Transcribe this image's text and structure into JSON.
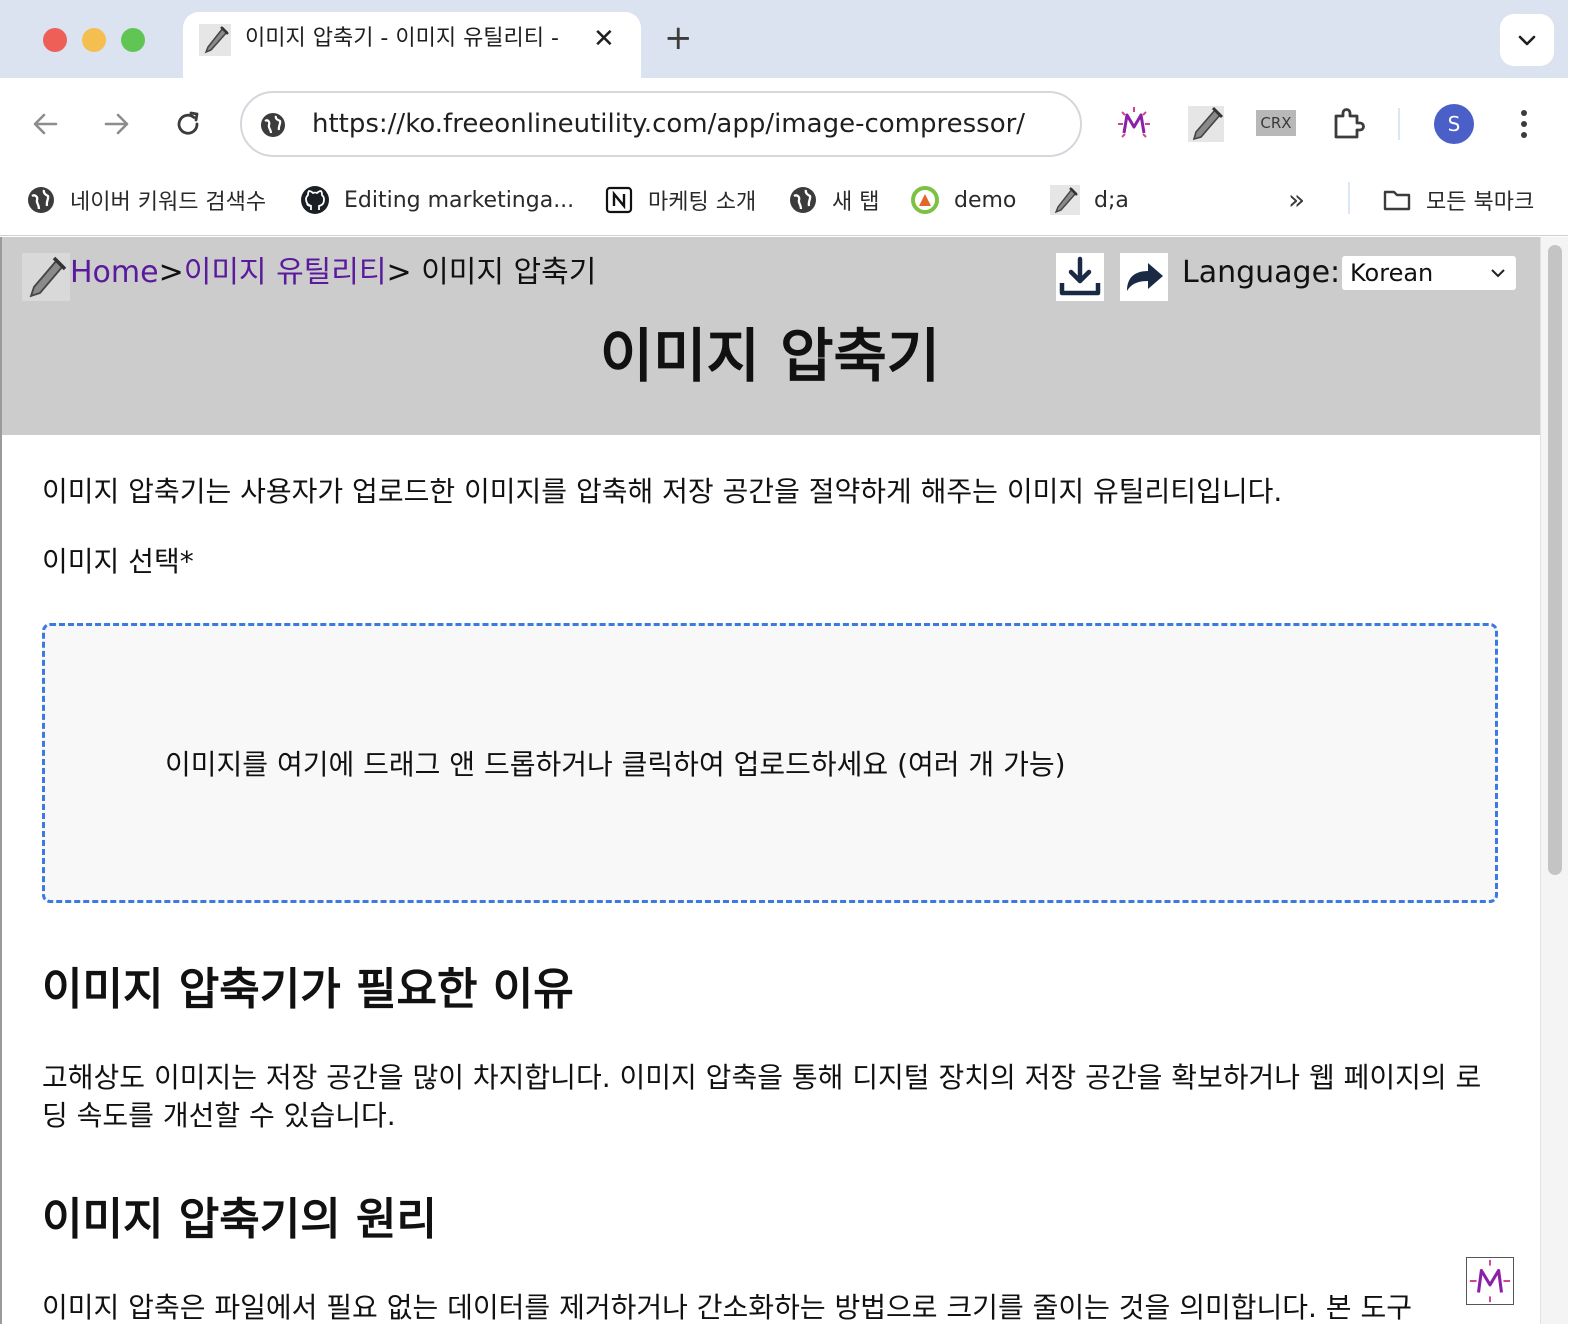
{
  "tab": {
    "title": "이미지 압축기 - 이미지 유틸리티 -",
    "close_glyph": "✕",
    "new_tab_glyph": "+"
  },
  "toolbar": {
    "url": "https://ko.freeonlineutility.com/app/image-compressor/",
    "crx_label": "CRX",
    "avatar_letter": "S"
  },
  "bookmarks": {
    "items": [
      {
        "label": "네이버 키워드 검색수",
        "icon": "globe-icon"
      },
      {
        "label": "Editing marketinga...",
        "icon": "github-icon"
      },
      {
        "label": "마케팅 소개",
        "icon": "notion-icon"
      },
      {
        "label": "새 탭",
        "icon": "globe-icon"
      },
      {
        "label": "demo",
        "icon": "demo-logo-icon"
      },
      {
        "label": "d;a",
        "icon": "tool-icon"
      }
    ],
    "more_glyph": "»",
    "all_bookmarks_label": "모든 북마크"
  },
  "header": {
    "breadcrumb": {
      "home": "Home",
      "sep1": ">",
      "category": "이미지 유틸리티",
      "current": "> 이미지 압축기"
    },
    "language_label": "Language:",
    "language_value": "Korean",
    "title": "이미지 압축기"
  },
  "content": {
    "intro": "이미지 압축기는 사용자가 업로드한 이미지를 압축해 저장 공간을 절약하게 해주는 이미지 유틸리티입니다.",
    "select_label": "이미지 선택*",
    "dropzone_text": "이미지를 여기에 드래그 앤 드롭하거나 클릭하여 업로드하세요 (여러 개 가능)",
    "why_heading": "이미지 압축기가 필요한 이유",
    "why_body": "고해상도 이미지는 저장 공간을 많이 차지합니다. 이미지 압축을 통해 디지털 장치의 저장 공간을 확보하거나 웹 페이지의 로딩 속도를 개선할 수 있습니다.",
    "principle_heading": "이미지 압축기의 원리",
    "principle_body": "이미지 압축은 파일에서 필요 없는 데이터를 제거하거나 간소화하는 방법으로 크기를 줄이는 것을 의미합니다. 본 도구"
  },
  "colors": {
    "tabstrip": "#dce3f0",
    "header_bg": "#cccccc",
    "link": "#5a1a9c",
    "dropzone_border": "#3b7ae0",
    "avatar": "#4b5fc9"
  }
}
